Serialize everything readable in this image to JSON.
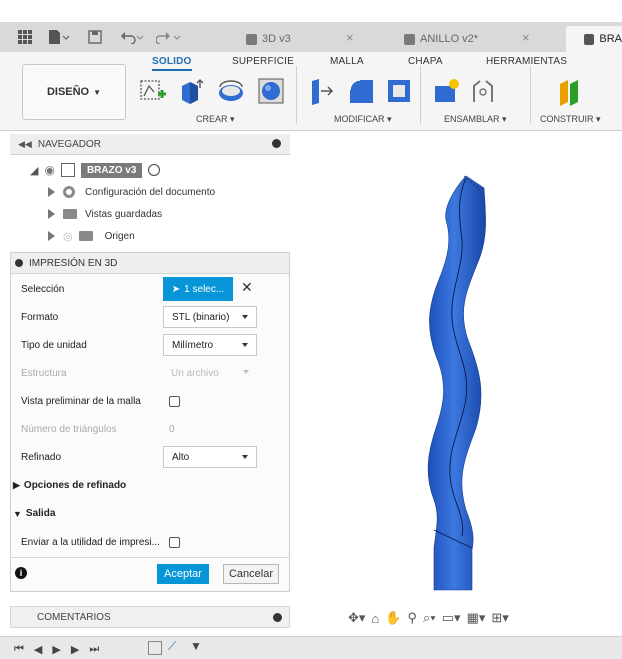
{
  "tabs": [
    {
      "label": "3D v3",
      "active": false
    },
    {
      "label": "ANILLO v2*",
      "active": false
    },
    {
      "label": "BRA",
      "active": true
    }
  ],
  "ribbon": {
    "design_label": "DISEÑO",
    "tabs": [
      "SOLIDO",
      "SUPERFICIE",
      "MALLA",
      "CHAPA",
      "HERRAMIENTAS"
    ],
    "groups": [
      "CREAR",
      "MODIFICAR",
      "ENSAMBLAR",
      "CONSTRUIR"
    ],
    "accent": "#1f6fb5"
  },
  "browser": {
    "title": "NAVEGADOR",
    "root": "BRAZO v3",
    "items": [
      "Configuración del documento",
      "Vistas guardadas",
      "Origen"
    ]
  },
  "print_panel": {
    "title": "IMPRESIÓN EN 3D",
    "seleccion_label": "Selección",
    "seleccion_value": "1 selec...",
    "formato_label": "Formato",
    "formato_value": "STL (binario)",
    "unidad_label": "Tipo de unidad",
    "unidad_value": "Milímetro",
    "estructura_label": "Estructura",
    "estructura_value": "Un archivo",
    "vista_label": "Vista preliminar de la malla",
    "triangulos_label": "Número de triángulos",
    "triangulos_value": "0",
    "refinado_label": "Refinado",
    "refinado_value": "Alto",
    "opciones_label": "Opciones de refinado",
    "salida_label": "Salida",
    "enviar_label": "Enviar a la utilidad de impresi...",
    "aceptar": "Aceptar",
    "cancelar": "Cancelar"
  },
  "comments": {
    "label": "COMENTARIOS"
  },
  "model_color": "#2f6bd0"
}
